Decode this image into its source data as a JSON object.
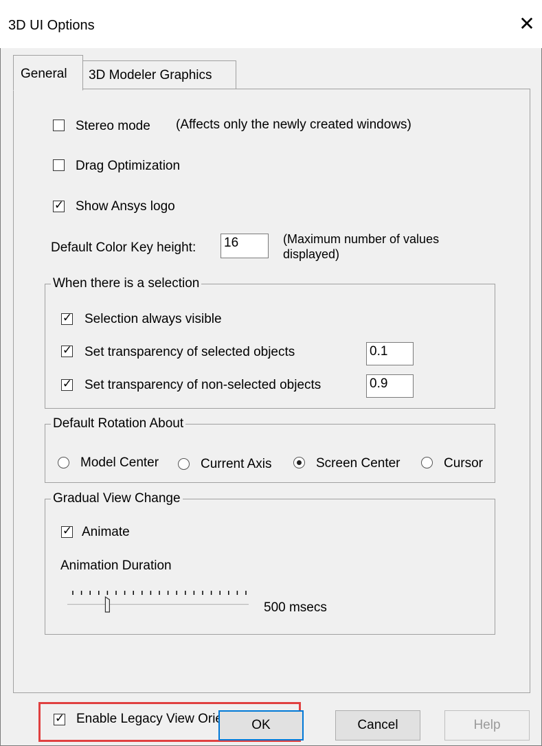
{
  "window": {
    "title": "3D UI Options",
    "close_glyph": "✕"
  },
  "tabs": [
    {
      "label": "General",
      "active": true
    },
    {
      "label": "3D Modeler Graphics",
      "active": false
    }
  ],
  "general": {
    "stereo_mode": {
      "label": "Stereo mode",
      "checked": false,
      "note": "(Affects only the newly created windows)"
    },
    "drag_optimization": {
      "label": "Drag Optimization",
      "checked": false
    },
    "show_logo": {
      "label": "Show Ansys logo",
      "checked": true
    },
    "color_key": {
      "label": "Default Color Key height:",
      "value": "16",
      "note_line1": "(Maximum number of values",
      "note_line2": "displayed)"
    }
  },
  "selection_group": {
    "legend": "When there is a selection",
    "always_visible": {
      "label": "Selection always visible",
      "checked": true
    },
    "transp_selected": {
      "label": "Set transparency of selected objects",
      "checked": true,
      "value": "0.1"
    },
    "transp_nonselected": {
      "label": "Set transparency of non-selected objects",
      "checked": true,
      "value": "0.9"
    }
  },
  "rotation_group": {
    "legend": "Default Rotation About",
    "options": [
      {
        "label": "Model Center",
        "selected": false
      },
      {
        "label": "Current Axis",
        "selected": false
      },
      {
        "label": "Screen Center",
        "selected": true
      },
      {
        "label": "Cursor",
        "selected": false
      }
    ]
  },
  "view_change_group": {
    "legend": "Gradual View Change",
    "animate": {
      "label": "Animate",
      "checked": true
    },
    "duration_label": "Animation Duration",
    "slider_fraction": 0.2,
    "slider_value_text": "500 msecs"
  },
  "legacy": {
    "label": "Enable Legacy View Orientation",
    "checked": true
  },
  "buttons": {
    "ok": "OK",
    "cancel": "Cancel",
    "help": "Help"
  },
  "colors": {
    "highlight": "#e04040",
    "ok_border": "#0078d7"
  }
}
